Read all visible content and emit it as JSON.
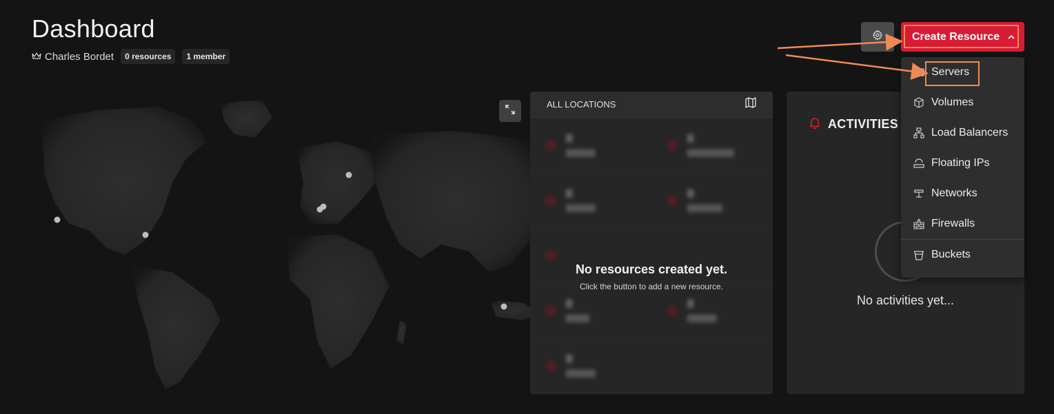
{
  "header": {
    "title": "Dashboard",
    "owner_name": "Charles Bordet",
    "resources_badge": "0 resources",
    "members_badge": "1 member"
  },
  "toolbar": {
    "create_label": "Create Resource"
  },
  "create_menu": {
    "items": [
      {
        "label": "Servers",
        "icon": "server-icon"
      },
      {
        "label": "Volumes",
        "icon": "cube-icon"
      },
      {
        "label": "Load Balancers",
        "icon": "load-balancer-icon"
      },
      {
        "label": "Floating IPs",
        "icon": "floating-ip-icon"
      },
      {
        "label": "Networks",
        "icon": "network-icon"
      },
      {
        "label": "Firewalls",
        "icon": "firewall-icon"
      },
      {
        "label": "Buckets",
        "icon": "bucket-icon"
      }
    ]
  },
  "locations": {
    "header_label": "ALL LOCATIONS",
    "empty_title": "No resources created yet.",
    "empty_subtitle": "Click the button to add a new resource."
  },
  "activities": {
    "title": "ACTIVITIES",
    "empty_text": "No activities yet..."
  },
  "colors": {
    "accent": "#d81b34",
    "annotation": "#f08a55",
    "background": "#141414",
    "panel": "#262626"
  }
}
